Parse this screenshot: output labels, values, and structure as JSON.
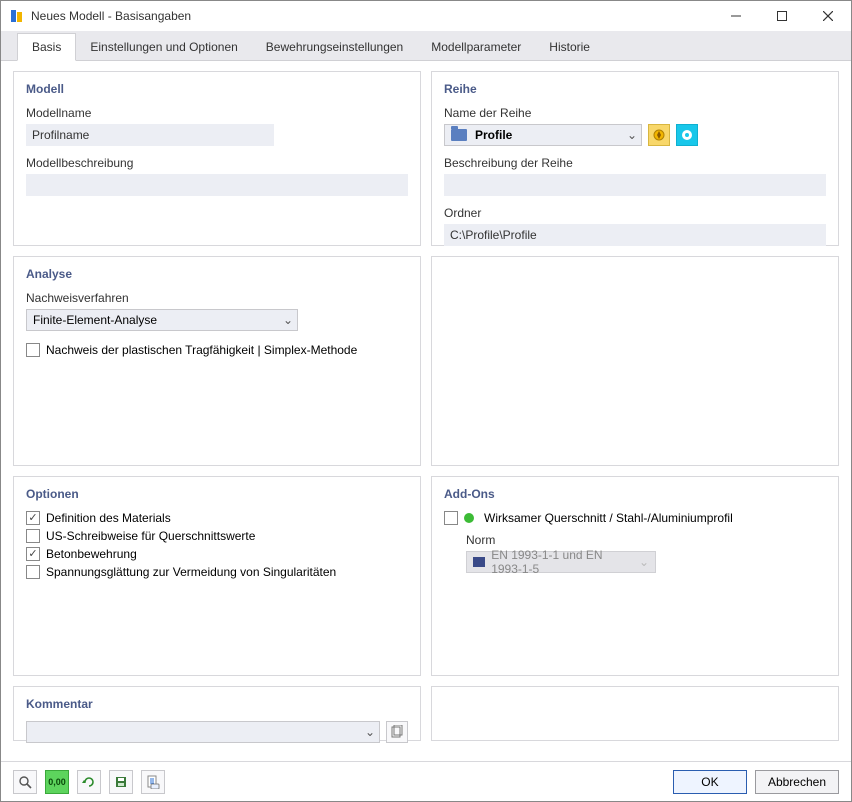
{
  "window": {
    "title": "Neues Modell - Basisangaben",
    "buttons": {
      "minimize": "—",
      "maximize": "▢",
      "close": "✕"
    }
  },
  "tabs": {
    "basis": "Basis",
    "einstellungen": "Einstellungen und Optionen",
    "bewehrung": "Bewehrungseinstellungen",
    "modellparameter": "Modellparameter",
    "historie": "Historie"
  },
  "modell": {
    "title": "Modell",
    "name_label": "Modellname",
    "name_value": "Profilname",
    "desc_label": "Modellbeschreibung",
    "desc_value": ""
  },
  "reihe": {
    "title": "Reihe",
    "name_label": "Name der Reihe",
    "selected": "Profile",
    "desc_label": "Beschreibung der Reihe",
    "desc_value": "",
    "folder_label": "Ordner",
    "folder_value": "C:\\Profile\\Profile"
  },
  "analyse": {
    "title": "Analyse",
    "verfahren_label": "Nachweisverfahren",
    "verfahren_value": "Finite-Element-Analyse",
    "plastisch_label": "Nachweis der plastischen Tragfähigkeit | Simplex-Methode",
    "plastisch_checked": false
  },
  "optionen": {
    "title": "Optionen",
    "items": [
      {
        "label": "Definition des Materials",
        "checked": true
      },
      {
        "label": "US-Schreibweise für Querschnittswerte",
        "checked": false
      },
      {
        "label": "Betonbewehrung",
        "checked": true
      },
      {
        "label": "Spannungsglättung zur Vermeidung von Singularitäten",
        "checked": false
      }
    ]
  },
  "addons": {
    "title": "Add-Ons",
    "item_label": "Wirksamer Querschnitt / Stahl-/Aluminiumprofil",
    "item_checked": false,
    "norm_label": "Norm",
    "norm_value": "EN 1993-1-1 und EN 1993-1-5"
  },
  "kommentar": {
    "title": "Kommentar",
    "value": ""
  },
  "footer": {
    "ok": "OK",
    "cancel": "Abbrechen"
  }
}
